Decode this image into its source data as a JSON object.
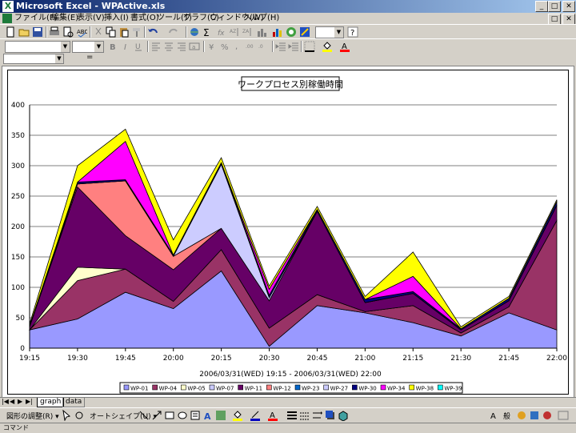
{
  "window": {
    "title": "Microsoft Excel - WPActive.xls"
  },
  "menu": [
    "ファイル(F)",
    "編集(E)",
    "表示(V)",
    "挿入(I)",
    "書式(O)",
    "ツール(T)",
    "グラフ(C)",
    "ウィンドウ(W)",
    "ヘルプ(H)"
  ],
  "sheet_tabs": [
    "graph",
    "data"
  ],
  "drawing_toolbar": {
    "adjust_label": "図形の調整(R) ▾",
    "autoshape_label": "オートシェイプ(U) ▾"
  },
  "status": {
    "text": "コマンド"
  },
  "colors": {
    "WP-01": "#9999ff",
    "WP-04": "#993366",
    "WP-05": "#ffffcc",
    "WP-07": "#ccccff",
    "WP-11": "#660066",
    "WP-12": "#ff8080",
    "WP-23": "#0066cc",
    "WP-27": "#ccccff",
    "WP-30": "#000080",
    "WP-34": "#ff00ff",
    "WP-38": "#ffff00",
    "WP-39": "#00ffff"
  },
  "chart_data": {
    "type": "area",
    "stacked": true,
    "title": "ワークプロセス別稼働時間",
    "xlabel": "2006/03/31(WED) 19:15 - 2006/03/31(WED) 22:00",
    "ylabel": "",
    "ylim": [
      0,
      400
    ],
    "yticks": [
      0,
      50,
      100,
      150,
      200,
      250,
      300,
      350,
      400
    ],
    "categories": [
      "19:15",
      "19:30",
      "19:45",
      "20:00",
      "20:15",
      "20:30",
      "20:45",
      "21:00",
      "21:15",
      "21:30",
      "21:45",
      "22:00"
    ],
    "legend_position": "bottom",
    "series": [
      {
        "name": "WP-01",
        "values": [
          30,
          48,
          92,
          65,
          127,
          3,
          70,
          58,
          42,
          20,
          58,
          30
        ]
      },
      {
        "name": "WP-04",
        "values": [
          0,
          63,
          38,
          12,
          35,
          30,
          18,
          2,
          28,
          5,
          10,
          180
        ]
      },
      {
        "name": "WP-05",
        "values": [
          0,
          22,
          0,
          0,
          0,
          0,
          0,
          0,
          0,
          0,
          0,
          0
        ]
      },
      {
        "name": "WP-07",
        "values": [
          0,
          0,
          0,
          0,
          0,
          0,
          0,
          0,
          0,
          0,
          0,
          0
        ]
      },
      {
        "name": "WP-11",
        "values": [
          5,
          132,
          55,
          52,
          35,
          45,
          137,
          15,
          20,
          5,
          10,
          25
        ]
      },
      {
        "name": "WP-12",
        "values": [
          0,
          5,
          90,
          22,
          0,
          0,
          0,
          0,
          0,
          0,
          0,
          0
        ]
      },
      {
        "name": "WP-23",
        "values": [
          0,
          0,
          0,
          0,
          0,
          0,
          0,
          0,
          0,
          0,
          0,
          0
        ]
      },
      {
        "name": "WP-27",
        "values": [
          0,
          0,
          0,
          0,
          105,
          5,
          0,
          0,
          0,
          0,
          0,
          0
        ]
      },
      {
        "name": "WP-30",
        "values": [
          2,
          3,
          2,
          2,
          3,
          4,
          3,
          5,
          3,
          2,
          4,
          6
        ]
      },
      {
        "name": "WP-34",
        "values": [
          0,
          0,
          63,
          0,
          0,
          10,
          0,
          0,
          25,
          0,
          0,
          0
        ]
      },
      {
        "name": "WP-38",
        "values": [
          3,
          27,
          20,
          25,
          8,
          5,
          5,
          5,
          40,
          3,
          3,
          3
        ]
      },
      {
        "name": "WP-39",
        "values": [
          0,
          0,
          0,
          0,
          0,
          0,
          0,
          0,
          0,
          0,
          0,
          0
        ]
      }
    ]
  }
}
